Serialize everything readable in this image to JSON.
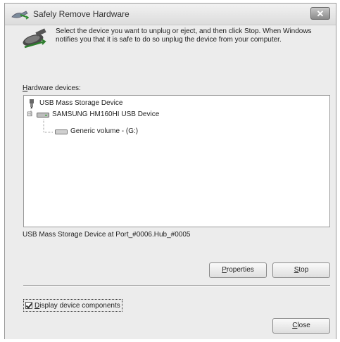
{
  "window": {
    "title": "Safely Remove Hardware",
    "close_glyph": "✕"
  },
  "instructions": "Select the device you want to unplug or eject, and then click Stop. When Windows notifies you that it is safe to do so unplug the device from your computer.",
  "hardware_devices_label": {
    "accel": "H",
    "rest": "ardware devices:"
  },
  "tree": {
    "items": [
      {
        "label": "USB Mass Storage Device",
        "icon": "usb-plug-icon",
        "expander": ""
      },
      {
        "label": "SAMSUNG HM160HI USB Device",
        "icon": "disk-drive-icon",
        "expander": "⊟"
      },
      {
        "label": "Generic volume - (G:)",
        "icon": "volume-icon",
        "expander": ""
      }
    ]
  },
  "status_text": "USB Mass Storage Device at Port_#0006.Hub_#0005",
  "buttons": {
    "properties": {
      "accel": "P",
      "rest": "roperties"
    },
    "stop": {
      "accel": "S",
      "rest": "top"
    },
    "close": {
      "accel": "C",
      "rest": "lose"
    }
  },
  "display_components": {
    "checked": true,
    "accel": "D",
    "rest": "isplay device components"
  }
}
